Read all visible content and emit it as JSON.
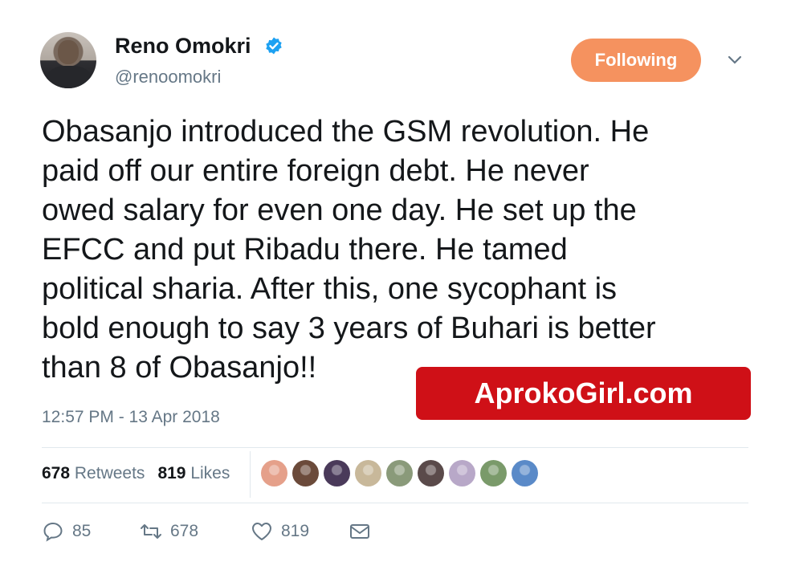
{
  "user": {
    "name": "Reno Omokri",
    "handle": "@renoomokri",
    "follow_label": "Following"
  },
  "tweet": {
    "text": "Obasanjo introduced the GSM revolution. He\npaid off our entire foreign debt. He never\nowed salary for even one day. He set up the\nEFCC and put Ribadu there. He tamed\npolitical sharia. After this, one sycophant is\nbold enough to say 3 years of Buhari is better\nthan 8 of Obasanjo!!",
    "timestamp": "12:57 PM - 13 Apr 2018"
  },
  "watermark": "AprokoGirl.com",
  "stats": {
    "retweets_count": "678",
    "retweets_label": "Retweets",
    "likes_count": "819",
    "likes_label": "Likes"
  },
  "likers": [
    {
      "color": "#e5a08a"
    },
    {
      "color": "#6b4a3a"
    },
    {
      "color": "#4a3a5a"
    },
    {
      "color": "#c8b89a"
    },
    {
      "color": "#8a9a7a"
    },
    {
      "color": "#5a4a4a"
    },
    {
      "color": "#b8a8c8"
    },
    {
      "color": "#7a9a6a"
    },
    {
      "color": "#5a8ac8"
    }
  ],
  "actions": {
    "reply_count": "85",
    "retweet_count": "678",
    "like_count": "819"
  },
  "colors": {
    "follow_button": "#f5925f",
    "verified": "#1da1f2",
    "watermark_bg": "#cf1017"
  },
  "icons": [
    "verified-badge-icon",
    "chevron-down-icon",
    "reply-icon",
    "retweet-icon",
    "heart-icon",
    "message-icon"
  ]
}
